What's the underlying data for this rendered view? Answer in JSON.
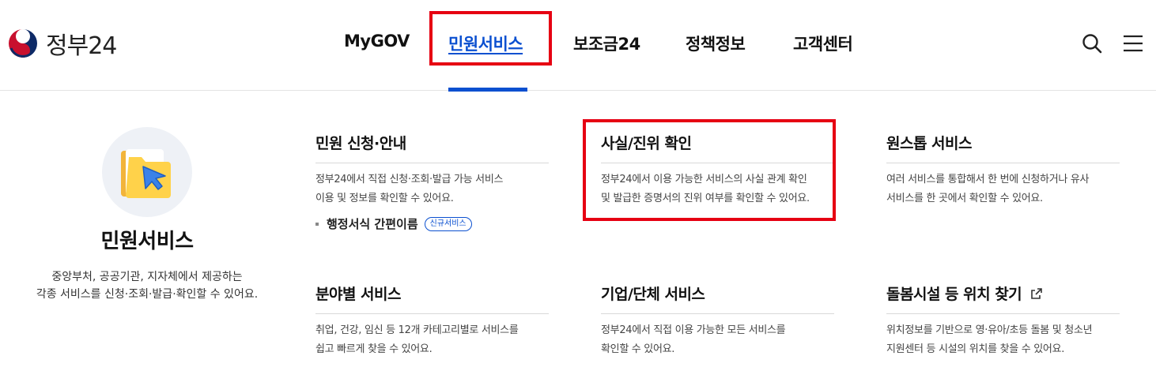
{
  "brand": {
    "name": "정부24"
  },
  "nav": {
    "items": [
      "MyGOV",
      "민원서비스",
      "보조금24",
      "정책정보",
      "고객센터"
    ],
    "active_index": 1
  },
  "header_icons": {
    "search": "search-icon",
    "menu": "hamburger-menu-icon"
  },
  "intro": {
    "icon": "folder-cursor-icon",
    "title": "민원서비스",
    "desc_line1": "중앙부처, 공공기관, 지자체에서 제공하는",
    "desc_line2": "각종 서비스를 신청·조회·발급·확인할 수 있어요."
  },
  "cards": [
    {
      "title": "민원 신청·안내",
      "desc_line1": "정부24에서 직접 신청·조회·발급 가능 서비스",
      "desc_line2": "이용 및 정보를 확인할 수 있어요.",
      "sub_link": "행정서식 간편이름",
      "sub_badge": "신규서비스"
    },
    {
      "title": "사실/진위 확인",
      "desc_line1": "정부24에서 이용 가능한 서비스의 사실 관계 확인",
      "desc_line2": "및 발급한 증명서의 진위 여부를 확인할 수 있어요."
    },
    {
      "title": "원스톱 서비스",
      "desc_line1": "여러 서비스를 통합해서 한 번에 신청하거나 유사",
      "desc_line2": "서비스를 한 곳에서 확인할 수 있어요."
    },
    {
      "title": "분야별 서비스",
      "desc_line1": "취업, 건강, 임신 등 12개 카테고리별로 서비스를",
      "desc_line2": "쉽고 빠르게 찾을 수 있어요."
    },
    {
      "title": "기업/단체 서비스",
      "desc_line1": "정부24에서 직접 이용 가능한 모든 서비스를",
      "desc_line2": "확인할 수 있어요."
    },
    {
      "title": "돌봄시설 등 위치 찾기",
      "title_icon": "external-link-icon",
      "desc_line1": "위치정보를 기반으로 영·유아/초등 돌봄 및 청소년",
      "desc_line2": "지원센터 등 시설의 위치를 찾을 수 있어요."
    }
  ],
  "colors": {
    "accent": "#0b50d0",
    "highlight": "#e60012",
    "text": "#111111"
  }
}
